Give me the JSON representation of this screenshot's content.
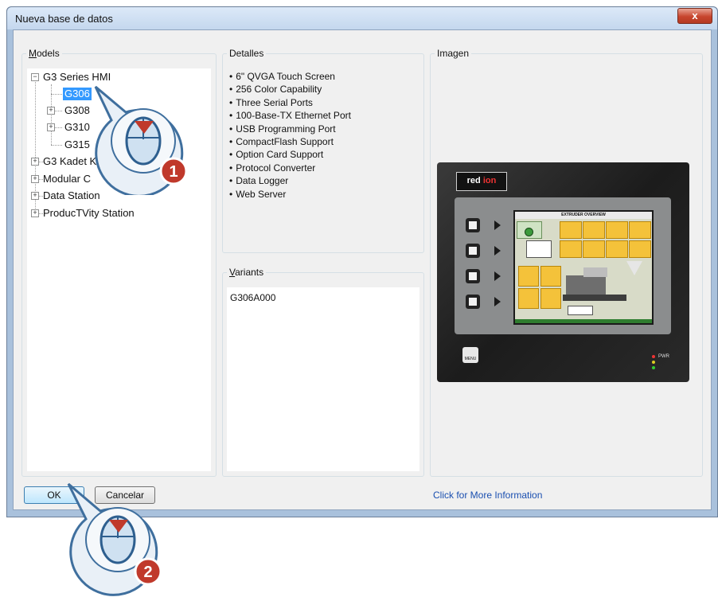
{
  "window": {
    "title": "Nueva base de datos",
    "close_label": "x"
  },
  "models": {
    "legend_accel": "M",
    "legend_rest": "odels",
    "tree": [
      {
        "label": "G3 Series HMI",
        "expander": "−"
      },
      {
        "label": "G306",
        "selected": true
      },
      {
        "label": "G308",
        "expander": "+"
      },
      {
        "label": "G310",
        "expander": "+"
      },
      {
        "label": "G315"
      },
      {
        "label": "G3 Kadet K",
        "expander": "+"
      },
      {
        "label": "Modular C",
        "expander": "+"
      },
      {
        "label": "Data Station",
        "expander": "+"
      },
      {
        "label": "ProducTVity Station",
        "expander": "+"
      }
    ]
  },
  "details": {
    "legend": "Detalles",
    "items": [
      "6\" QVGA Touch Screen",
      "256 Color Capability",
      "Three Serial Ports",
      "100-Base-TX Ethernet Port",
      "USB Programming Port",
      "CompactFlash Support",
      "Option Card Support",
      "Protocol Converter",
      "Data Logger",
      "Web Server"
    ]
  },
  "variants": {
    "legend_accel": "V",
    "legend_rest": "ariants",
    "items": [
      "G306A000"
    ]
  },
  "image": {
    "legend": "Imagen",
    "logo_left": "red ",
    "logo_right": "ion",
    "screen_title": "EXTRUDER OVERVIEW",
    "menu_label": "MENU",
    "pwr_label": "PWR"
  },
  "buttons": {
    "ok": "OK",
    "cancel": "Cancelar",
    "more_info": "Click for More Information"
  },
  "callouts": {
    "step1": "1",
    "step2": "2"
  },
  "colors": {
    "selection": "#3399ff",
    "callout_badge": "#c0392b",
    "link": "#1a4fb0"
  }
}
